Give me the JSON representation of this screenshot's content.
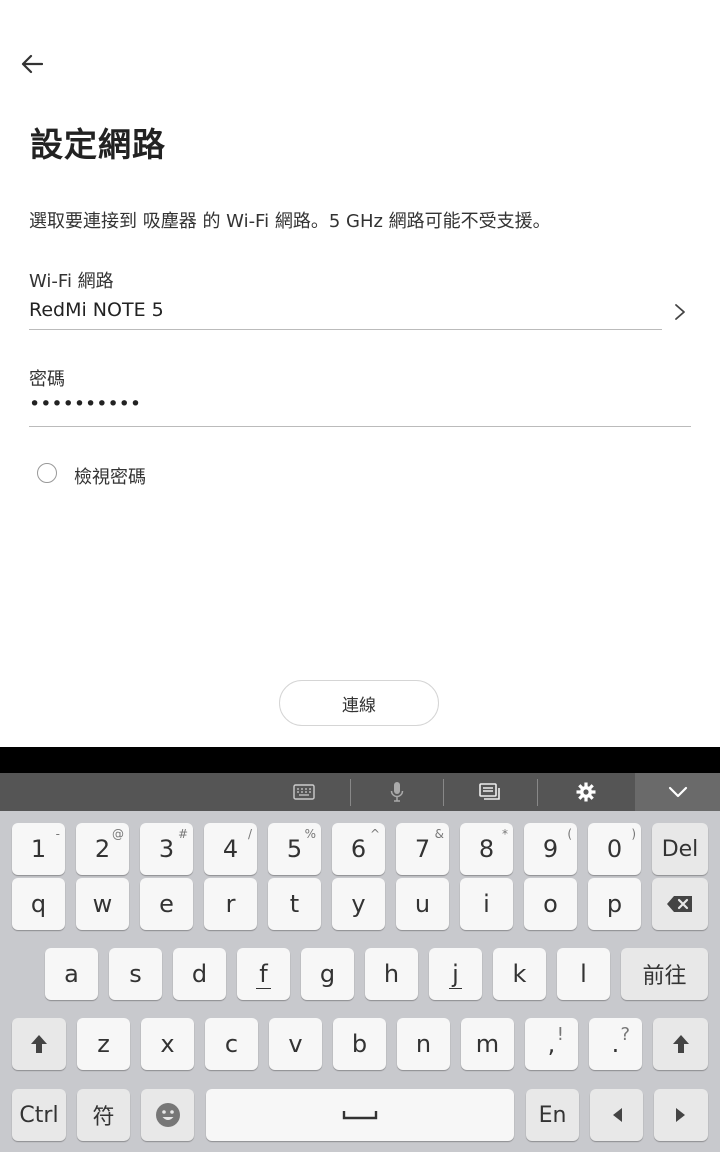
{
  "screen": {
    "title": "設定網路",
    "description": "選取要連接到 吸塵器 的 Wi-Fi 網路。5 GHz 網路可能不受支援。",
    "wifi_label": "Wi-Fi 網路",
    "wifi_value": "RedMi NOTE 5",
    "password_label": "密碼",
    "password_value": "••••••••••",
    "show_password_label": "檢視密碼",
    "connect_label": "連線"
  },
  "keyboard": {
    "toolbar": {
      "icons": [
        "keyboard-icon",
        "microphone-icon",
        "clipboard-icon",
        "gear-icon",
        "chevron-down-icon"
      ]
    },
    "row1": [
      {
        "main": "1",
        "sup": "-"
      },
      {
        "main": "2",
        "sup": "@"
      },
      {
        "main": "3",
        "sup": "#"
      },
      {
        "main": "4",
        "sup": "/"
      },
      {
        "main": "5",
        "sup": "%"
      },
      {
        "main": "6",
        "sup": "^"
      },
      {
        "main": "7",
        "sup": "&"
      },
      {
        "main": "8",
        "sup": "*"
      },
      {
        "main": "9",
        "sup": "("
      },
      {
        "main": "0",
        "sup": ")"
      }
    ],
    "del_label": "Del",
    "row2": [
      "q",
      "w",
      "e",
      "r",
      "t",
      "y",
      "u",
      "i",
      "o",
      "p"
    ],
    "row3": [
      "a",
      "s",
      "d",
      "f",
      "g",
      "h",
      "j",
      "k",
      "l"
    ],
    "go_label": "前往",
    "row4": [
      "z",
      "x",
      "c",
      "v",
      "b",
      "n",
      "m"
    ],
    "comma_key": {
      "main": ",",
      "sup": "!"
    },
    "period_key": {
      "main": ".",
      "sup": "?"
    },
    "ctrl_label": "Ctrl",
    "symbol_label": "符",
    "lang_label": "En"
  }
}
